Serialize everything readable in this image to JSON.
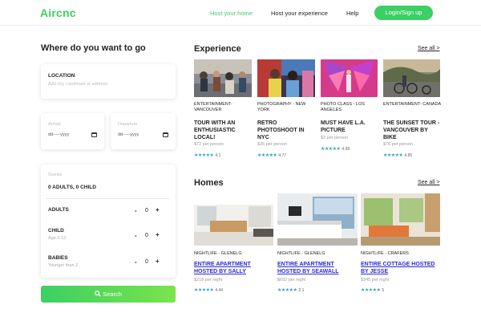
{
  "nav": {
    "logo": "Aircnc",
    "links": [
      "Host your home",
      "Host your experience",
      "Help"
    ],
    "login_label": "Login/Sign up"
  },
  "search": {
    "heading": "Where do you want to go",
    "location_label": "LOCATION",
    "location_placeholder": "Add city, Landmark or address",
    "arrival_label": "Arrival",
    "arrival_placeholder": "dd-----yyyy",
    "departure_label": "Departure",
    "departure_placeholder": "dd-----yyyy",
    "guests_label": "Guests",
    "guests_summary": "0 ADULTS, 0 CHILD",
    "rows": [
      {
        "label": "ADULTS",
        "sub": "",
        "value": "0"
      },
      {
        "label": "CHILD",
        "sub": "Age 2-12",
        "value": "0"
      },
      {
        "label": "BABIES",
        "sub": "Younger than 2",
        "value": "0"
      }
    ],
    "minus": "-",
    "plus": "+",
    "button_label": "Search"
  },
  "experience": {
    "title": "Experience",
    "see_all": "See all >",
    "items": [
      {
        "category": "ENTERTAINMENT- VANCOUVER",
        "title": "TOUR WITH AN ENTHUSIASTIC LOCAL!",
        "price": "$72 per person",
        "rating": "4.1"
      },
      {
        "category": "PHOTOGRAPHY - NEW YORK",
        "title": "RETRO PHOTOSHOOT IN NYC",
        "price": "$35 per person",
        "rating": "4.77"
      },
      {
        "category": "PHOTO CLASS - LOS ANGELES",
        "title": "MUST HAVE L.A. PICTURE",
        "price": "$3 per person",
        "rating": "4.98"
      },
      {
        "category": "ENTERTAINMENT- CANADA",
        "title": "THE SUNSET TOUR - VANCOUVER BY BIKE",
        "price": "$76 per person",
        "rating": "4.85"
      }
    ]
  },
  "homes": {
    "title": "Homes",
    "see_all": "See all >",
    "items": [
      {
        "category": "NIGHTLIFE - GLENELG",
        "title": "ENTIRE APARTMENT HOSTED BY SALLY",
        "price": "$218 per night",
        "rating": "4.44"
      },
      {
        "category": "NIGHTLIFE - GLENELG",
        "title": "ENTIRE APARTMENT HOSTED BY SEAWALL",
        "price": "$692 per night",
        "rating": "2.1"
      },
      {
        "category": "NIGHTLIFE - CRAFERS",
        "title": "ENTIRE COTTAGE HOSTED BY JESSE",
        "price": "$345 per night",
        "rating": "5"
      }
    ]
  },
  "stars": "★★★★★",
  "colors": {
    "accent": "#3ccf64",
    "link": "#2b2bd6",
    "star": "#35a3b8"
  }
}
